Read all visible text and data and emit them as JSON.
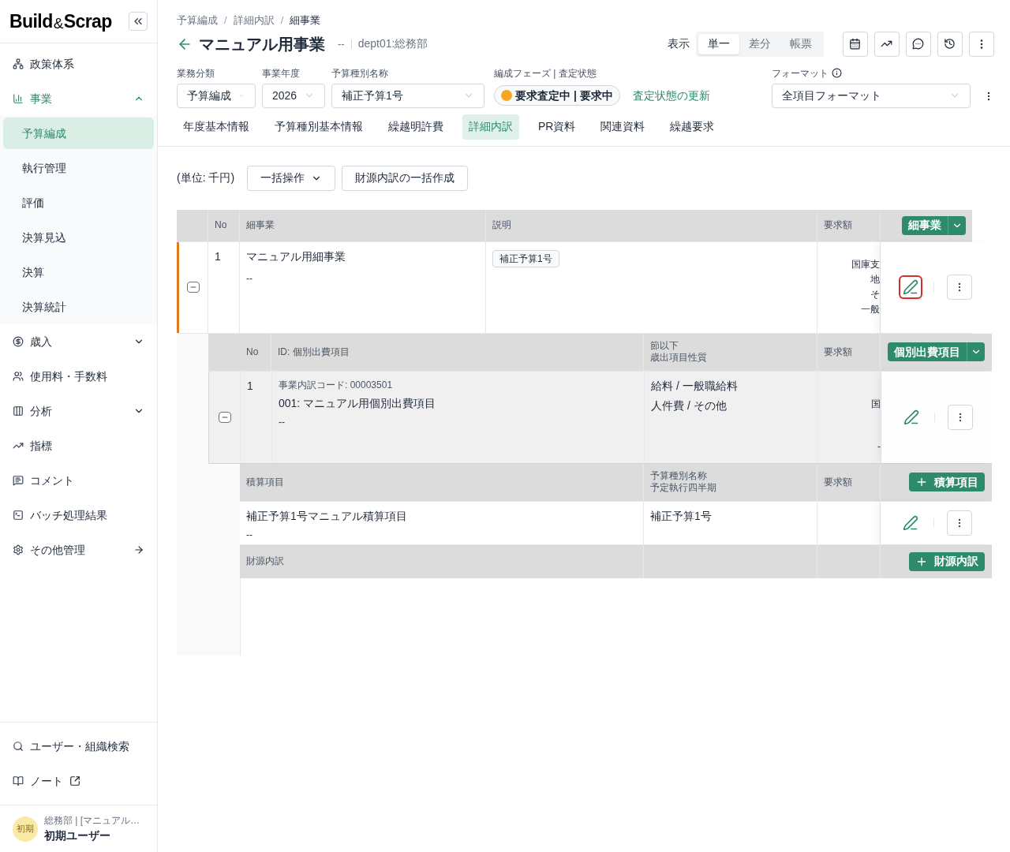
{
  "sidebar": {
    "logo": {
      "left": "Build",
      "mid": "&",
      "right": "Scrap"
    },
    "items": [
      {
        "label": "政策体系",
        "kind": "item"
      },
      {
        "label": "事業",
        "kind": "group",
        "expanded": true,
        "children": [
          {
            "label": "予算編成",
            "selected": true
          },
          {
            "label": "執行管理",
            "selected": false
          },
          {
            "label": "評価",
            "selected": false
          },
          {
            "label": "決算見込",
            "selected": false
          },
          {
            "label": "決算",
            "selected": false
          },
          {
            "label": "決算統計",
            "selected": false
          }
        ]
      },
      {
        "label": "歳入",
        "kind": "group",
        "expanded": false
      },
      {
        "label": "使用料・手数料",
        "kind": "item"
      },
      {
        "label": "分析",
        "kind": "group",
        "expanded": false
      },
      {
        "label": "指標",
        "kind": "item"
      },
      {
        "label": "コメント",
        "kind": "item"
      },
      {
        "label": "バッチ処理結果",
        "kind": "item"
      },
      {
        "label": "その他管理",
        "kind": "link"
      }
    ],
    "bottom": [
      {
        "label": "ユーザー・組織検索",
        "external": false
      },
      {
        "label": "ノート",
        "external": true
      }
    ],
    "user": {
      "avatar": "初期",
      "org": "総務部 | [マニュアル…",
      "name": "初期ユーザー"
    }
  },
  "header": {
    "breadcrumb": [
      "予算編成",
      "詳細内訳",
      "細事業"
    ],
    "separator": "/",
    "title": "マニュアル用事業",
    "code": "--",
    "dept": "dept01:総務部",
    "view": {
      "label": "表示",
      "options": [
        {
          "label": "単一",
          "selected": true
        },
        {
          "label": "差分",
          "selected": false
        },
        {
          "label": "帳票",
          "selected": false
        }
      ]
    }
  },
  "filters": [
    {
      "label": "業務分類",
      "value": "予算編成"
    },
    {
      "label": "事業年度",
      "value": "2026"
    },
    {
      "label": "予算種別名称",
      "value": "補正予算1号"
    }
  ],
  "phase": {
    "label": "編成フェーズ | 査定状態",
    "value": "要求査定中 | 要求中",
    "color": "#f5a623",
    "link": "査定状態の更新"
  },
  "format": {
    "label": "フォーマット",
    "value": "全項目フォーマット"
  },
  "tabs": [
    {
      "label": "年度基本情報",
      "selected": false
    },
    {
      "label": "予算種別基本情報",
      "selected": false
    },
    {
      "label": "繰越明許費",
      "selected": false
    },
    {
      "label": "詳細内訳",
      "selected": true
    },
    {
      "label": "PR資料",
      "selected": false
    },
    {
      "label": "関連資料",
      "selected": false
    },
    {
      "label": "繰越要求",
      "selected": false
    }
  ],
  "toolbar": {
    "unit": "(単位: 千円)",
    "bulk": "一括操作",
    "create": "財源内訳の一括作成"
  },
  "table": {
    "level1": {
      "headers": [
        "No",
        "細事業",
        "説明",
        "要求額"
      ],
      "action": "細事業",
      "row": {
        "no": "1",
        "name": "マニュアル用細事業",
        "sub": "--",
        "tag": "補正予算1号",
        "amounts": [
          "国庫支",
          "地",
          "そ",
          "一般"
        ],
        "expanded": true,
        "edit_focused": true
      }
    },
    "level2": {
      "headers": [
        "No",
        "ID: 個別出費項目",
        [
          "節以下",
          "歳出項目性質"
        ],
        "要求額"
      ],
      "action": "個別出費項目",
      "row": {
        "no": "1",
        "code": "事業内訳コード: 00003501",
        "name": "001: マニュアル用個別出費項目",
        "sub": "--",
        "props": [
          "給料 / 一般職給料",
          "人件費 / その他"
        ],
        "amounts": [
          "国",
          "-"
        ],
        "expanded": true,
        "edit_focused": false
      }
    },
    "level3": {
      "headers": [
        "積算項目",
        [
          "予算種別名称",
          "予定執行四半期"
        ],
        "要求額"
      ],
      "action": "積算項目",
      "row": {
        "name": "補正予算1号マニュアル積算項目",
        "sub": "--",
        "budget": "補正予算1号",
        "edit_focused": false
      }
    },
    "level4": {
      "headers": [
        "財源内訳"
      ],
      "action": "財源内訳"
    }
  }
}
